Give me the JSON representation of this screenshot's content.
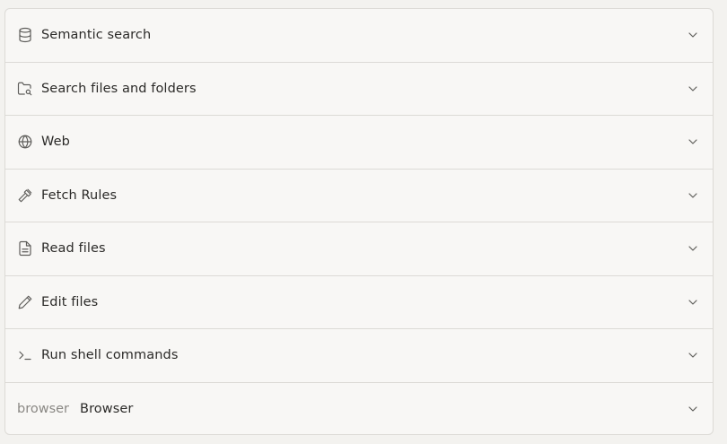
{
  "tools": [
    {
      "label": "Semantic search",
      "icon": "database-icon"
    },
    {
      "label": "Search files and folders",
      "icon": "folder-search-icon"
    },
    {
      "label": "Web",
      "icon": "globe-icon"
    },
    {
      "label": "Fetch Rules",
      "icon": "hammer-icon"
    },
    {
      "label": "Read files",
      "icon": "file-text-icon"
    },
    {
      "label": "Edit files",
      "icon": "pencil-icon"
    },
    {
      "label": "Run shell commands",
      "icon": "terminal-icon"
    },
    {
      "prefix": "browser",
      "label": "Browser"
    }
  ]
}
